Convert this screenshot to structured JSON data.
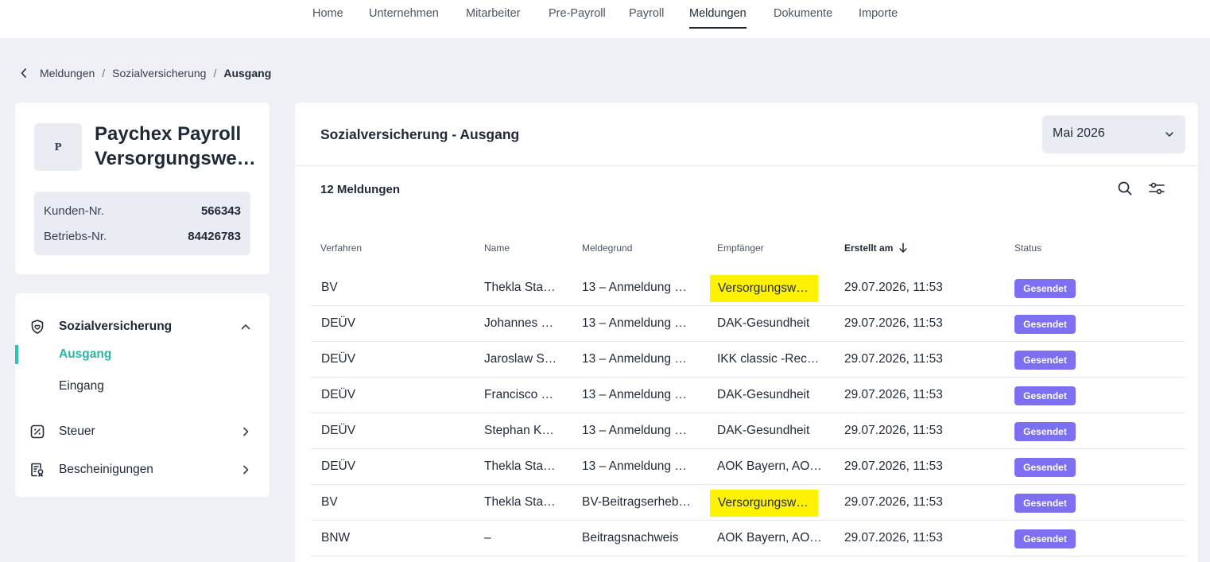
{
  "nav": {
    "items": [
      {
        "label": "Home",
        "active": false
      },
      {
        "label": "Unternehmen",
        "active": false
      },
      {
        "label": "Mitarbeiter",
        "active": false
      },
      {
        "label": "Pre-Payroll",
        "active": false
      },
      {
        "label": "Payroll",
        "active": false
      },
      {
        "label": "Meldungen",
        "active": true
      },
      {
        "label": "Dokumente",
        "active": false
      },
      {
        "label": "Importe",
        "active": false
      }
    ]
  },
  "breadcrumb": {
    "items": [
      "Meldungen",
      "Sozialversicherung"
    ],
    "current": "Ausgang"
  },
  "company": {
    "logo_letter": "P",
    "name_line1": "Paychex Payroll",
    "name_line2": "Versorgungswer…",
    "customer_no_label": "Kunden-Nr.",
    "customer_no": "566343",
    "business_no_label": "Betriebs-Nr.",
    "business_no": "84426783"
  },
  "side_menu": {
    "sozialversicherung": "Sozialversicherung",
    "ausgang": "Ausgang",
    "eingang": "Eingang",
    "steuer": "Steuer",
    "bescheinigungen": "Bescheinigungen"
  },
  "panel": {
    "title": "Sozialversicherung - Ausgang",
    "month": "Mai 2026",
    "count": "12 Meldungen"
  },
  "table": {
    "headers": {
      "verfahren": "Verfahren",
      "name": "Name",
      "meldegrund": "Meldegrund",
      "empfaenger": "Empfänger",
      "erstellt": "Erstellt am",
      "status": "Status"
    },
    "rows": [
      {
        "verfahren": "BV",
        "name": "Thekla Sta…",
        "meldegrund": "13 – Anmeldung …",
        "empfaenger": "Versorgungswer…",
        "erstellt": "29.07.2026, 11:53",
        "status": "Gesendet",
        "highlight": true
      },
      {
        "verfahren": "DEÜV",
        "name": "Johannes …",
        "meldegrund": "13 – Anmeldung …",
        "empfaenger": "DAK-Gesundheit",
        "erstellt": "29.07.2026, 11:53",
        "status": "Gesendet",
        "highlight": false
      },
      {
        "verfahren": "DEÜV",
        "name": "Jaroslaw S…",
        "meldegrund": "13 – Anmeldung …",
        "empfaenger": "IKK classic -Rec…",
        "erstellt": "29.07.2026, 11:53",
        "status": "Gesendet",
        "highlight": false
      },
      {
        "verfahren": "DEÜV",
        "name": "Francisco …",
        "meldegrund": "13 – Anmeldung …",
        "empfaenger": "DAK-Gesundheit",
        "erstellt": "29.07.2026, 11:53",
        "status": "Gesendet",
        "highlight": false
      },
      {
        "verfahren": "DEÜV",
        "name": "Stephan K…",
        "meldegrund": "13 – Anmeldung …",
        "empfaenger": "DAK-Gesundheit",
        "erstellt": "29.07.2026, 11:53",
        "status": "Gesendet",
        "highlight": false
      },
      {
        "verfahren": "DEÜV",
        "name": "Thekla Sta…",
        "meldegrund": "13 – Anmeldung …",
        "empfaenger": "AOK Bayern, AO…",
        "erstellt": "29.07.2026, 11:53",
        "status": "Gesendet",
        "highlight": false
      },
      {
        "verfahren": "BV",
        "name": "Thekla Sta…",
        "meldegrund": "BV-Beitragserheb…",
        "empfaenger": "Versorgungswer…",
        "erstellt": "29.07.2026, 11:53",
        "status": "Gesendet",
        "highlight": true
      },
      {
        "verfahren": "BNW",
        "name": "–",
        "meldegrund": "Beitragsnachweis",
        "empfaenger": "AOK Bayern, AO…",
        "erstellt": "29.07.2026, 11:53",
        "status": "Gesendet",
        "highlight": false
      }
    ]
  },
  "colors": {
    "accent_teal": "#2bb5a7",
    "status_badge": "#7c6ff2",
    "highlight": "#fff200",
    "page_bg": "#eef0f5"
  }
}
